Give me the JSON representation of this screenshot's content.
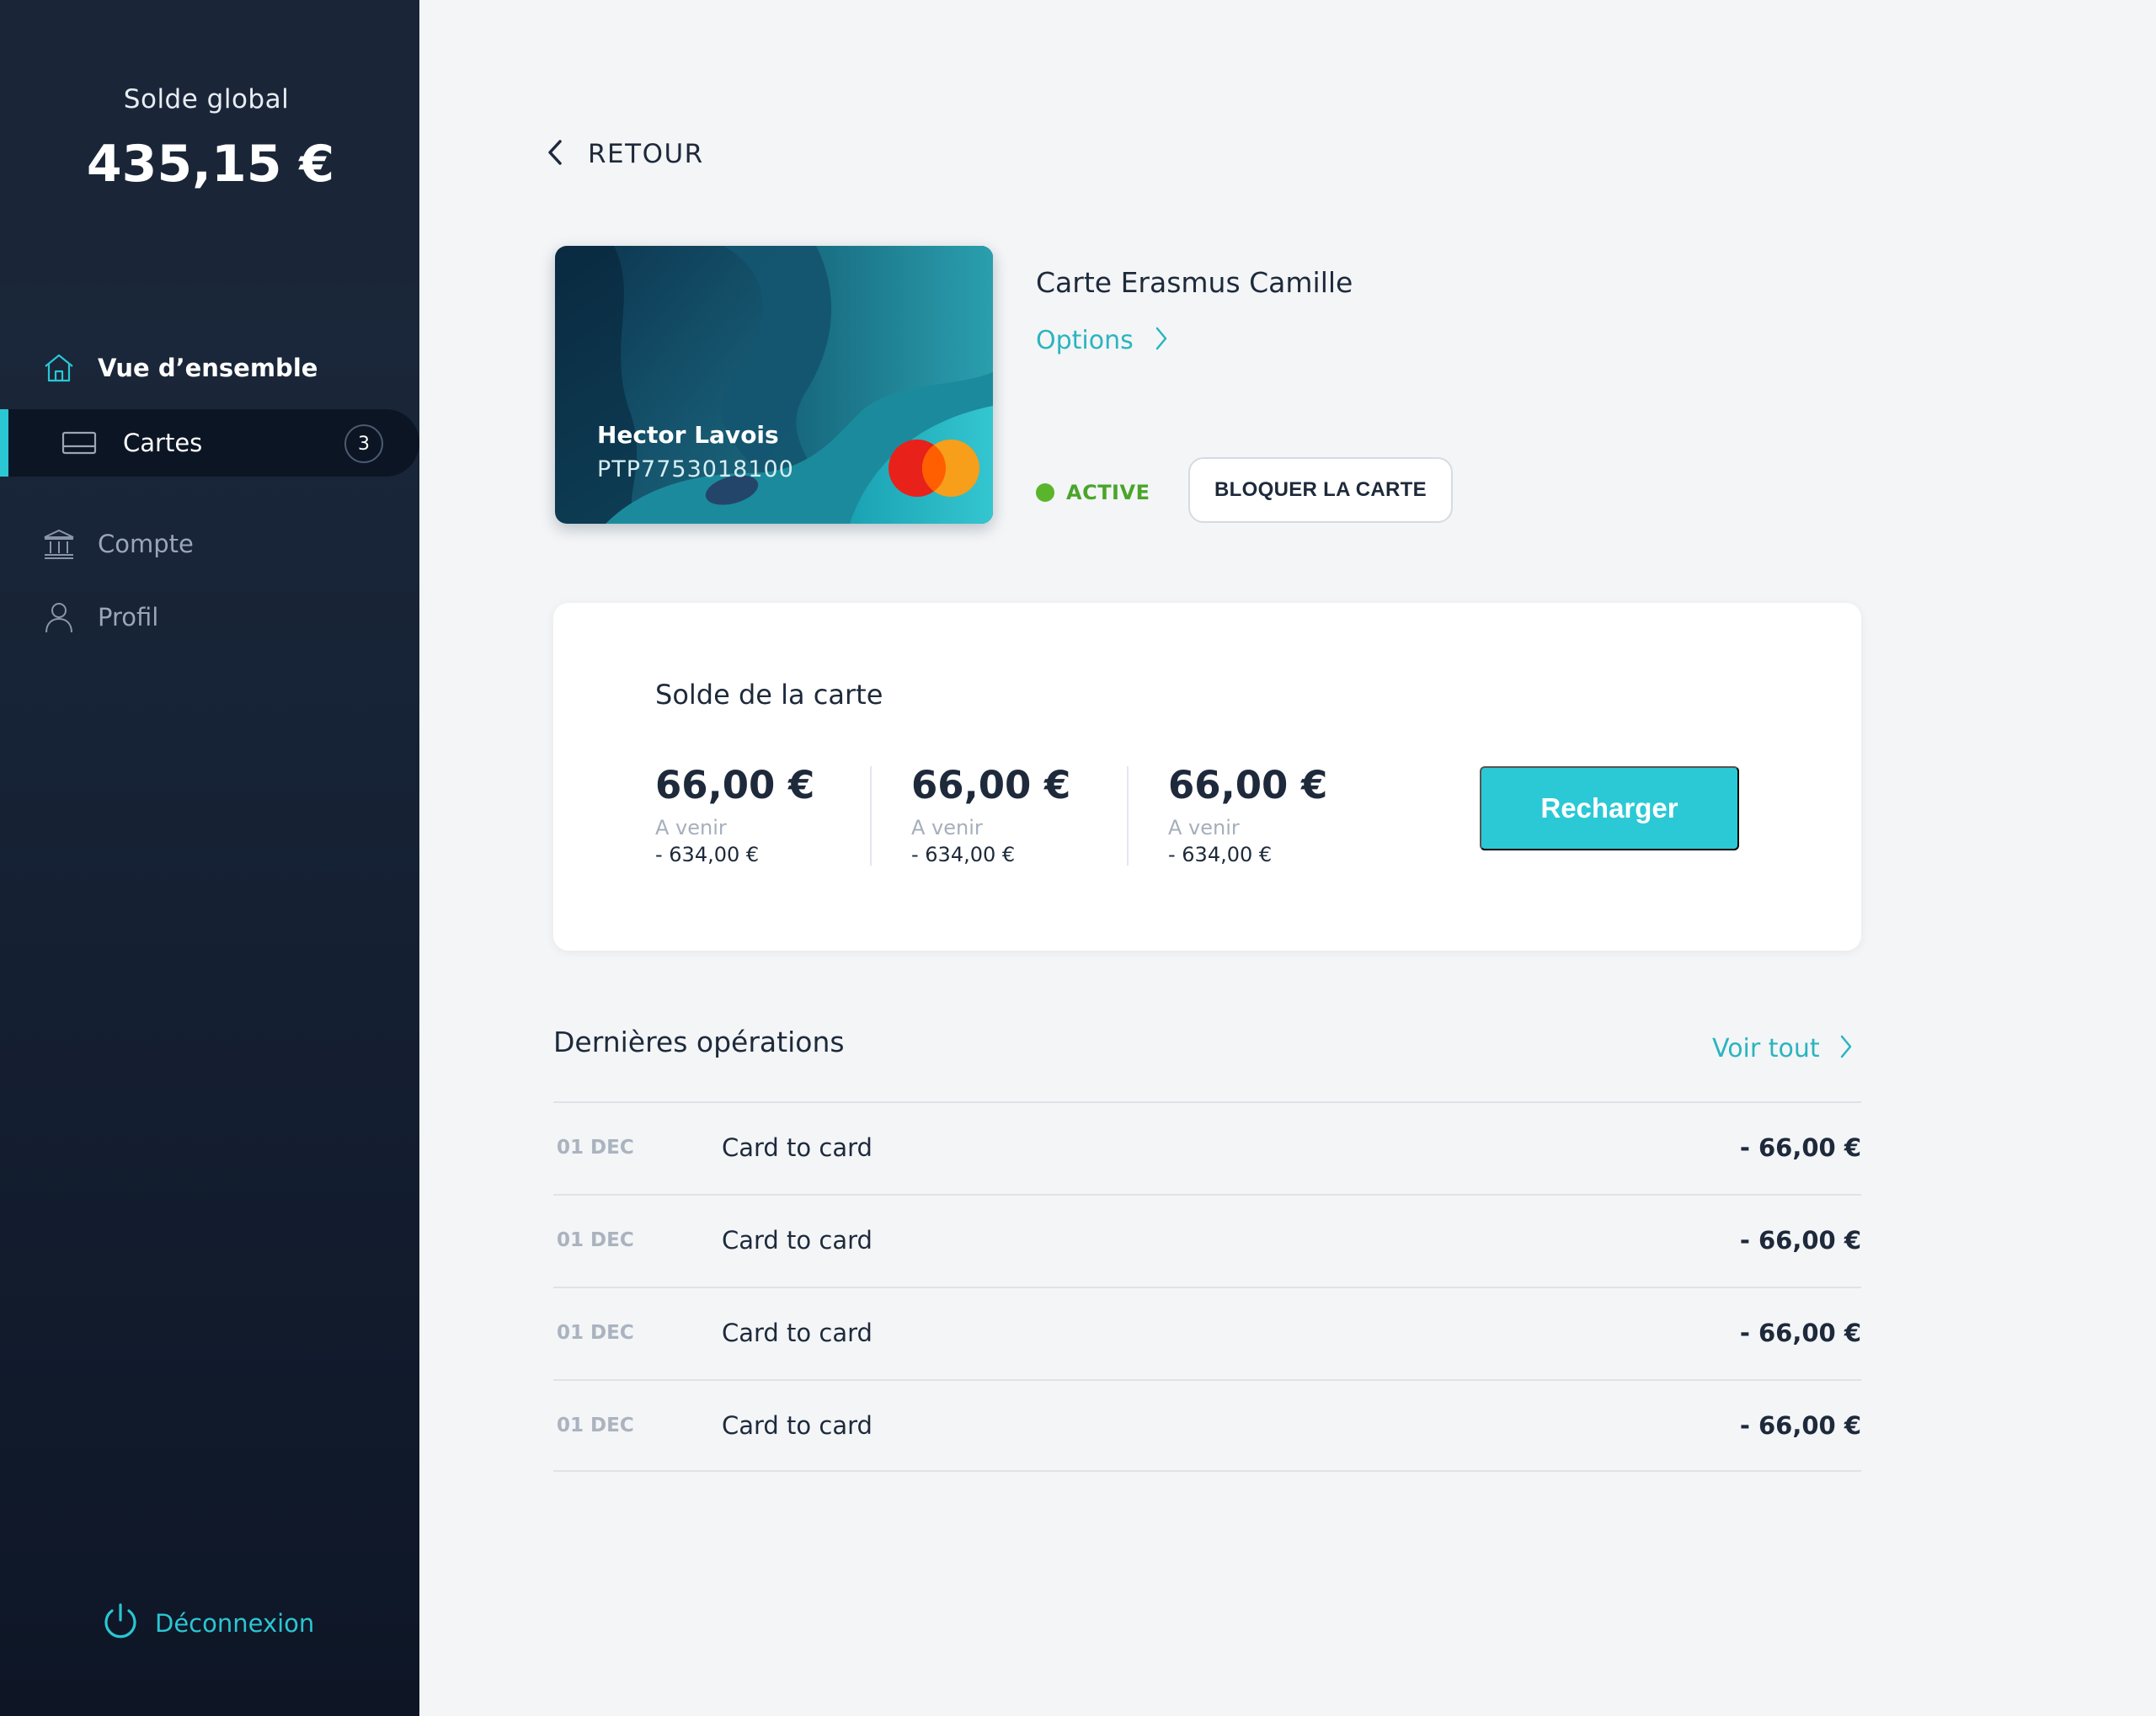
{
  "colors": {
    "accent": "#2bc6d3",
    "sidebar_bg": "#162235",
    "active_status": "#5ab52c",
    "background": "#f3f5f7"
  },
  "sidebar": {
    "global_balance_label": "Solde global",
    "global_balance_amount": "435,15 €",
    "nav": [
      {
        "label": "Vue d’ensemble",
        "icon": "home-icon"
      },
      {
        "label": "Cartes",
        "icon": "card-icon",
        "badge": "3"
      },
      {
        "label": "Compte",
        "icon": "bank-icon"
      },
      {
        "label": "Profil",
        "icon": "user-icon"
      }
    ],
    "logout_label": "Déconnexion"
  },
  "main": {
    "back_label": "RETOUR",
    "card": {
      "holder": "Hector Lavois",
      "number": "PTP7753018100",
      "title": "Carte Erasmus Camille",
      "options_label": "Options",
      "status": "ACTIVE",
      "block_label": "BLOQUER LA CARTE"
    },
    "balance": {
      "title": "Solde de la carte",
      "columns": [
        {
          "amount": "66,00 €",
          "sub_label": "A venir",
          "sub_amount": "- 634,00 €"
        },
        {
          "amount": "66,00 €",
          "sub_label": "A venir",
          "sub_amount": "- 634,00 €"
        },
        {
          "amount": "66,00 €",
          "sub_label": "A venir",
          "sub_amount": "- 634,00 €"
        }
      ],
      "recharge_label": "Recharger"
    },
    "operations": {
      "title": "Dernières opérations",
      "see_all_label": "Voir tout",
      "rows": [
        {
          "date": "01 DEC",
          "label": "Card to card",
          "amount": "- 66,00 €"
        },
        {
          "date": "01 DEC",
          "label": "Card to card",
          "amount": "- 66,00 €"
        },
        {
          "date": "01 DEC",
          "label": "Card to card",
          "amount": "- 66,00 €"
        },
        {
          "date": "01 DEC",
          "label": "Card to card",
          "amount": "- 66,00 €"
        }
      ]
    }
  }
}
